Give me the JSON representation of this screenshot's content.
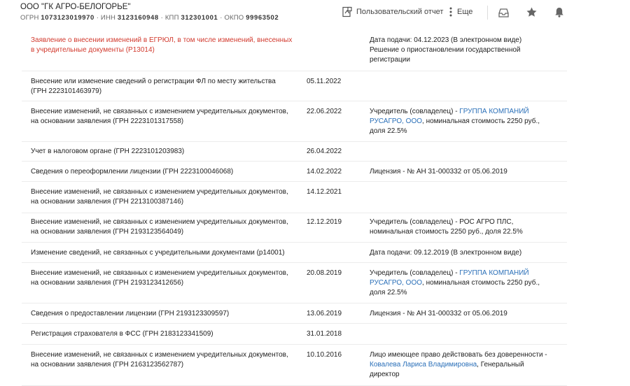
{
  "header": {
    "company_name": "ООО \"ГК АГРО-БЕЛОГОРЬЕ\"",
    "ids": [
      {
        "label": "ОГРН",
        "value": "1073123019970"
      },
      {
        "label": "ИНН",
        "value": "3123160948"
      },
      {
        "label": "КПП",
        "value": "312301001"
      },
      {
        "label": "ОКПО",
        "value": "99963502"
      }
    ],
    "report_label": "Пользовательский отчет",
    "more_label": "Еще"
  },
  "rows": [
    {
      "text": "Заявление о внесении изменений в ЕГРЮЛ, в том числе изменений, внесенных в учредительные документы (Р13014)",
      "date": "",
      "info": "Дата подачи: 04.12.2023 (В электронном виде) Решение о приостановлении государственной регистрации",
      "highlight": true,
      "info_parts": []
    },
    {
      "text": "Внесение или изменение сведений о регистрации ФЛ по месту жительства (ГРН 2223101463979)",
      "date": "05.11.2022",
      "info": "",
      "info_parts": []
    },
    {
      "text": "Внесение изменений, не связанных с изменением учредительных документов, на основании заявления (ГРН 2223101317558)",
      "date": "22.06.2022",
      "info": "",
      "info_parts": [
        {
          "text": "Учредитель (совладелец) - "
        },
        {
          "text": "ГРУППА КОМПАНИЙ РУСАГРО, ООО",
          "link": true
        },
        {
          "text": ", номинальная стоимость 2250 руб., доля 22.5%"
        }
      ]
    },
    {
      "text": "Учет в налоговом органе (ГРН 2223101203983)",
      "date": "26.04.2022",
      "info": "",
      "info_parts": []
    },
    {
      "text": "Сведения о переоформлении лицензии (ГРН 2223100046068)",
      "date": "14.02.2022",
      "info": "Лицензия - № АН 31-000332 от 05.06.2019",
      "info_parts": []
    },
    {
      "text": "Внесение изменений, не связанных с изменением учредительных документов, на основании заявления (ГРН 2213100387146)",
      "date": "14.12.2021",
      "info": "",
      "info_parts": []
    },
    {
      "text": "Внесение изменений, не связанных с изменением учредительных документов, на основании заявления (ГРН 2193123564049)",
      "date": "12.12.2019",
      "info": "Учредитель (совладелец) - РОС АГРО ПЛС, номинальная стоимость 2250 руб., доля 22.5%",
      "info_parts": []
    },
    {
      "text": "Изменение сведений, не связанных с учредительными документами (р14001)",
      "date": "",
      "info": "Дата подачи: 09.12.2019 (В электронном виде)",
      "info_parts": []
    },
    {
      "text": "Внесение изменений, не связанных с изменением учредительных документов, на основании заявления (ГРН 2193123412656)",
      "date": "20.08.2019",
      "info": "",
      "info_parts": [
        {
          "text": "Учредитель (совладелец) - "
        },
        {
          "text": "ГРУППА КОМПАНИЙ РУСАГРО, ООО",
          "link": true
        },
        {
          "text": ", номинальная стоимость 2250 руб., доля 22.5%"
        }
      ]
    },
    {
      "text": "Сведения о предоставлении лицензии (ГРН 2193123309597)",
      "date": "13.06.2019",
      "info": "Лицензия - № АН 31-000332 от 05.06.2019",
      "info_parts": []
    },
    {
      "text": "Регистрация страхователя в ФСС (ГРН 2183123341509)",
      "date": "31.01.2018",
      "info": "",
      "info_parts": []
    },
    {
      "text": "Внесение изменений, не связанных с изменением учредительных документов, на основании заявления (ГРН 2163123562787)",
      "date": "10.10.2016",
      "info": "",
      "info_parts": [
        {
          "text": "Лицо имеющее право действовать без доверенности - "
        },
        {
          "text": "Ковалева Лариса Владимировна",
          "link": true
        },
        {
          "text": ", Генеральный директор"
        }
      ]
    }
  ],
  "colors": {
    "highlight": "#d23a2e",
    "link": "#2a6fb8"
  }
}
